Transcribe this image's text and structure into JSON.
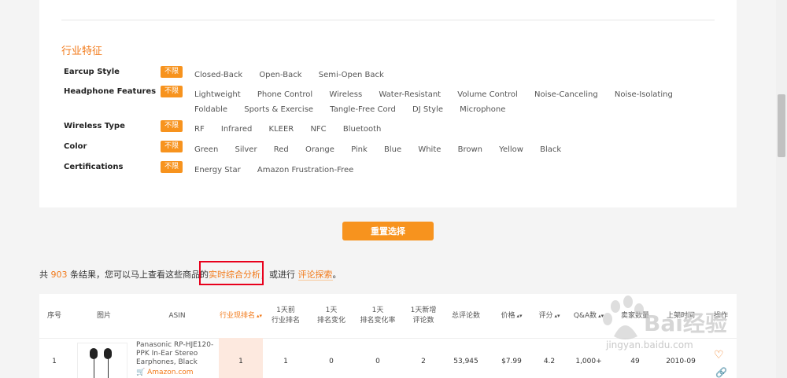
{
  "filter": {
    "section_title": "行业特征",
    "unlimited_label": "不限",
    "rows": [
      {
        "label": "Earcup Style",
        "options": [
          "Closed-Back",
          "Open-Back",
          "Semi-Open Back"
        ]
      },
      {
        "label": "Headphone Features",
        "options": [
          "Lightweight",
          "Phone Control",
          "Wireless",
          "Water-Resistant",
          "Volume Control",
          "Noise-Canceling",
          "Noise-Isolating",
          "Foldable",
          "Sports & Exercise",
          "Tangle-Free Cord",
          "DJ Style",
          "Microphone"
        ]
      },
      {
        "label": "Wireless Type",
        "options": [
          "RF",
          "Infrared",
          "KLEER",
          "NFC",
          "Bluetooth"
        ]
      },
      {
        "label": "Color",
        "options": [
          "Green",
          "Silver",
          "Red",
          "Orange",
          "Pink",
          "Blue",
          "White",
          "Brown",
          "Yellow",
          "Black"
        ]
      },
      {
        "label": "Certifications",
        "options": [
          "Energy Star",
          "Amazon Frustration-Free"
        ]
      }
    ]
  },
  "reset_label": "重置选择",
  "results": {
    "prefix": "共",
    "count": "903",
    "middle": "条结果，您可以马上查看这些商品的",
    "analysis_link": "实时综合分析",
    "connector": "，或进行",
    "review_link": "评论探索",
    "suffix": "。"
  },
  "table": {
    "headers": [
      "序号",
      "图片",
      "ASIN",
      "行业现排名",
      "1天前\n行业排名",
      "1天\n排名变化",
      "1天\n排名变化率",
      "1天新增\n评论数",
      "总评论数",
      "价格",
      "评分",
      "Q&A数",
      "卖家数量",
      "上架时间",
      "操作"
    ],
    "row": {
      "index": "1",
      "title": "Panasonic RP-HJE120-PPK In-Ear Stereo Earphones, Black",
      "store": "Amazon.com",
      "rank": "1",
      "rank_1d": "1",
      "rank_change": "0",
      "rank_change_rate": "0",
      "new_reviews": "2",
      "total_reviews": "53,945",
      "price": "$7.99",
      "rating": "4.2",
      "qa": "1,000+",
      "sellers": "49",
      "listed": "2010-09"
    }
  },
  "watermark": {
    "brand": "Bai经验",
    "url": "jingyan.baidu.com"
  },
  "colors": {
    "accent": "#f7931e",
    "highlight": "#e8001c"
  }
}
